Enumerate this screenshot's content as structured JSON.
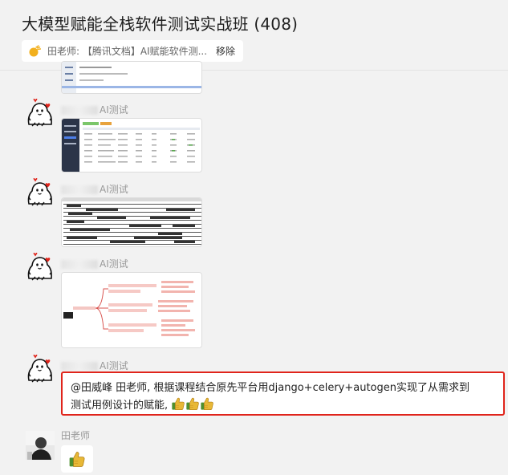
{
  "header": {
    "title": "大模型赋能全栈软件测试实战班 (408)"
  },
  "pinned": {
    "text": "田老师: 【腾讯文档】AI赋能软件测...",
    "remove_label": "移除"
  },
  "messages": [
    {
      "sender_suffix": "AI测试",
      "kind": "image"
    },
    {
      "sender_suffix": "AI测试",
      "kind": "image"
    },
    {
      "sender_suffix": "AI测试",
      "kind": "image"
    },
    {
      "sender_suffix": "AI测试",
      "kind": "image"
    },
    {
      "sender_suffix": "AI测试",
      "kind": "text"
    },
    {
      "sender": "田老师",
      "kind": "emoji",
      "emoji": "thumbs-up"
    }
  ],
  "highlighted_message": {
    "line1": "@田威峰 田老师, 根据课程结合原先平台用django+celery+autogen实现了从需求到",
    "line2": "测试用例设计的赋能,",
    "emoji_suffix": "thumbs-up x3",
    "highlight_color": "#e0241b"
  }
}
